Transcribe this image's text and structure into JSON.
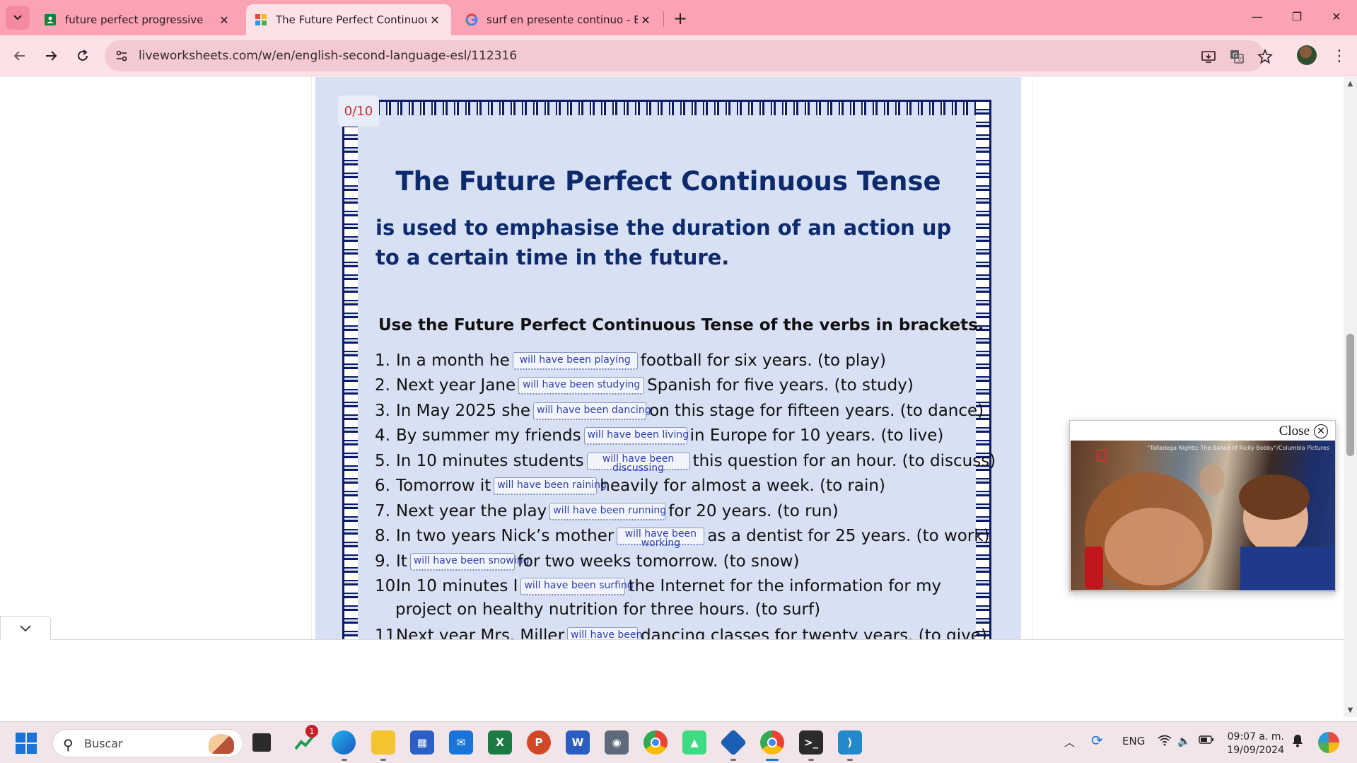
{
  "browser": {
    "tabs": [
      {
        "title": "future perfect progressive",
        "favicon": "green-forms-icon"
      },
      {
        "title": "The Future Perfect Continuous",
        "favicon": "liveworksheets-icon",
        "active": true
      },
      {
        "title": "surf en presente continuo - Bus",
        "favicon": "google-icon"
      }
    ],
    "close_glyph": "✕",
    "new_tab_glyph": "+",
    "url": "liveworksheets.com/w/en/english-second-language-esl/112316",
    "window_controls": {
      "minimize": "—",
      "restore": "❐",
      "close": "✕"
    }
  },
  "worksheet": {
    "score": "0/10",
    "title": "The Future Perfect Continuous Tense",
    "subtitle": "is used to emphasise the duration of an action up to a certain time in the future.",
    "instruction": "Use the Future Perfect Continuous Tense of the verbs in brackets.",
    "exercises": [
      {
        "num": "1.",
        "before": "In a month he",
        "answer": "will have been playing",
        "after": "football for six years. (to play)"
      },
      {
        "num": "2.",
        "before": "Next year Jane",
        "answer": "will have been studying",
        "after": "Spanish for five years. (to study)"
      },
      {
        "num": "3.",
        "before": "In May 2025 she",
        "answer": "will have been dancing",
        "after": "on this stage for fifteen years. (to dance)"
      },
      {
        "num": "4.",
        "before": "By summer my friends",
        "answer": "will have been living",
        "after": "in Europe for 10 years. (to live)"
      },
      {
        "num": "5.",
        "before": "In 10 minutes students",
        "answer": "will have been discussing",
        "after": "this question for an hour. (to discuss)"
      },
      {
        "num": "6.",
        "before": "Tomorrow it",
        "answer": "will have been raining",
        "after": "heavily for almost a week. (to rain)"
      },
      {
        "num": "7.",
        "before": "Next year the play",
        "answer": "will have been running",
        "after": "for 20 years. (to run)"
      },
      {
        "num": "8.",
        "before": "In two years Nick’s mother",
        "answer": "will have been working",
        "after": "as a dentist for 25 years. (to work)"
      },
      {
        "num": "9.",
        "before": "It",
        "answer": "will have been snowing",
        "after": "for two weeks tomorrow. (to snow)"
      },
      {
        "num": "10.",
        "before": "In 10 minutes I",
        "answer": "will have been surfing",
        "after": "the Internet for the information for my"
      },
      {
        "num": "11.",
        "before": "Next year Mrs. Miller",
        "answer": "will have been",
        "after": "dancing classes for twenty years. (to give)"
      }
    ],
    "exercise_10_continuation": "project on healthy nutrition for three hours. (to surf)"
  },
  "video_popup": {
    "close_label": "Close",
    "close_glyph": "✕",
    "caption": "\"Talladega Nights: The Ballad of Ricky Bobby\"/Columbia Pictures"
  },
  "taskbar": {
    "search_placeholder": "Buscar",
    "pinned_apps": [
      "task-view-icon",
      "stocks-icon",
      "edge-icon",
      "file-explorer-icon",
      "store-icon",
      "mail-icon",
      "excel-icon",
      "powerpoint-icon",
      "word-icon",
      "camera-icon",
      "chrome-icon",
      "android-studio-icon",
      "virtualbox-icon",
      "chrome-profile-icon",
      "terminal-icon",
      "vscode-icon"
    ],
    "stocks_badge": "1",
    "language": "ENG",
    "time": "09:07 a. m.",
    "date": "19/09/2024"
  },
  "colors": {
    "tabstrip": "#fba3b4",
    "toolbar": "#fce2e7",
    "worksheet_bg": "#d8e0f3",
    "worksheet_text": "#0d2a6c",
    "score": "#d5282f",
    "answer_text": "#2f3fb8"
  }
}
